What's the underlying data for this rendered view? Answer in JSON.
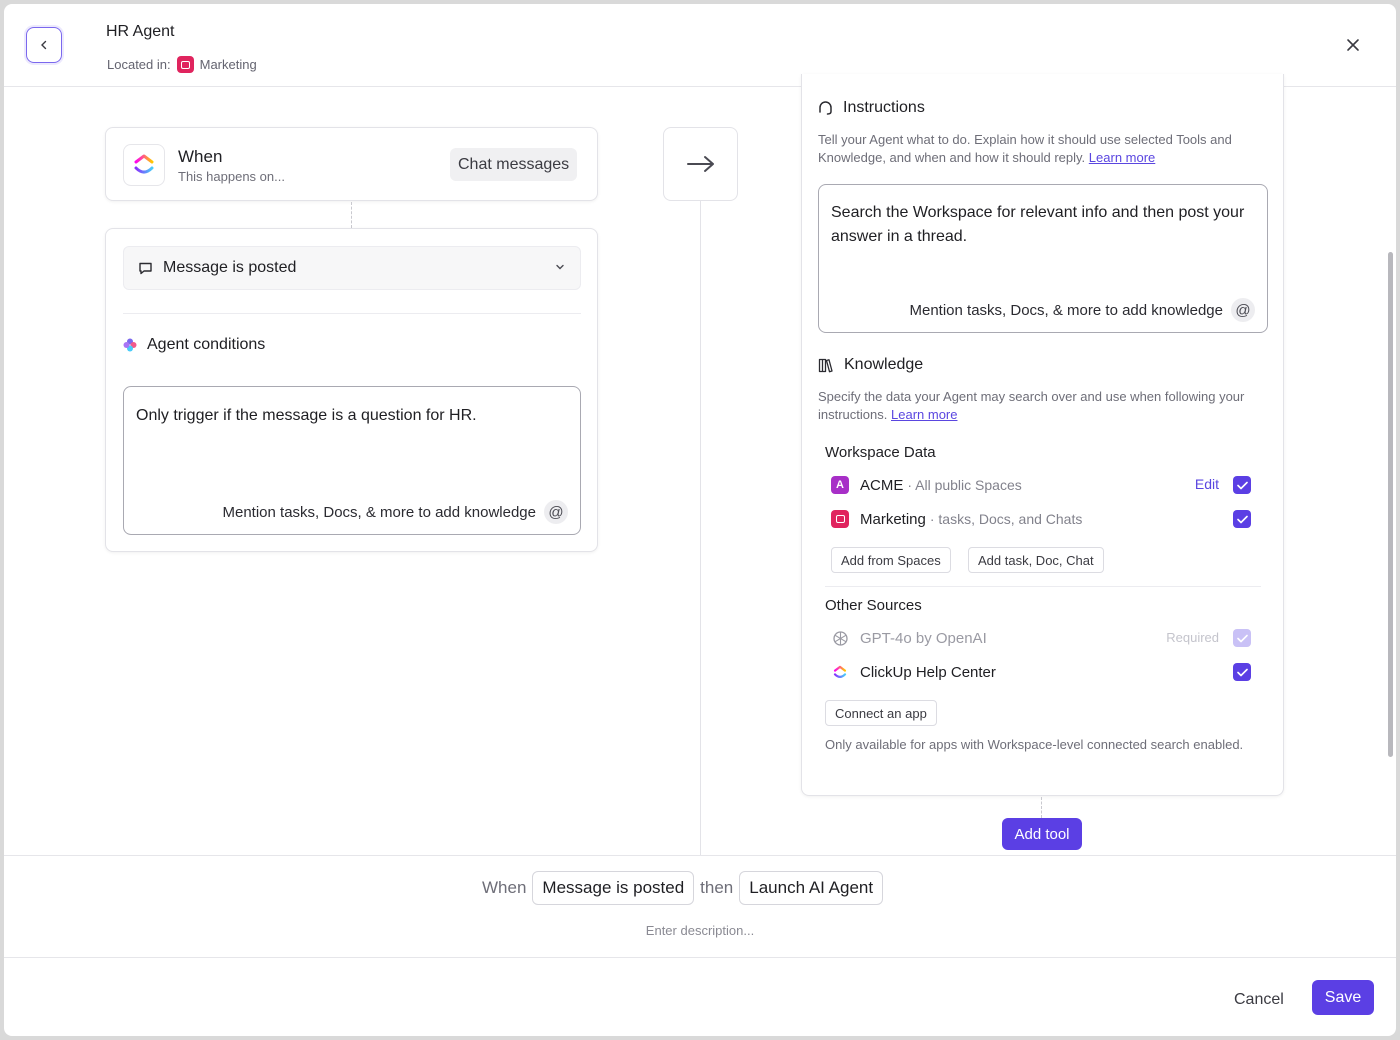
{
  "header": {
    "title": "HR Agent",
    "located_label": "Located in:",
    "located_space": "Marketing"
  },
  "trigger": {
    "when_title": "When",
    "when_subtitle": "This happens on...",
    "source_chip": "Chat messages",
    "event_select": "Message is posted",
    "conditions_title": "Agent conditions",
    "conditions_text": "Only trigger if the message is a question for HR.",
    "mention_hint": "Mention tasks, Docs, & more to add knowledge"
  },
  "instructions": {
    "title": "Instructions",
    "description": "Tell your Agent what to do. Explain how it should use selected Tools and Knowledge, and when and how it should reply.",
    "learn_more": "Learn more",
    "text": "Search the Workspace for relevant info and then post your answer in a thread.",
    "mention_hint": "Mention tasks, Docs, & more to add knowledge"
  },
  "knowledge": {
    "title": "Knowledge",
    "description": "Specify the data your Agent may search over and use when following your instructions.",
    "learn_more": "Learn more",
    "workspace_title": "Workspace Data",
    "workspace_items": [
      {
        "avatar": "A",
        "name": "ACME",
        "meta": "· All public Spaces",
        "action": "Edit",
        "checked": true
      },
      {
        "name": "Marketing",
        "meta": "· tasks, Docs, and Chats",
        "checked": true
      }
    ],
    "add_from_spaces": "Add from Spaces",
    "add_task_doc_chat": "Add task, Doc, Chat",
    "other_title": "Other Sources",
    "other_items": [
      {
        "name": "GPT-4o by OpenAI",
        "status": "Required",
        "checked": true,
        "disabled": true
      },
      {
        "name": "ClickUp Help Center",
        "checked": true
      }
    ],
    "connect_app": "Connect an app",
    "connect_note": "Only available for apps with Workspace-level connected search enabled."
  },
  "add_tool": "Add tool",
  "summary": {
    "when": "When",
    "trigger_chip": "Message is posted",
    "then": "then",
    "action_chip": "Launch AI Agent",
    "description_placeholder": "Enter description..."
  },
  "footer": {
    "cancel": "Cancel",
    "save": "Save"
  },
  "colors": {
    "accent": "#5b3fe4",
    "marketing": "#e0245e",
    "acme": "#a72fc7"
  }
}
